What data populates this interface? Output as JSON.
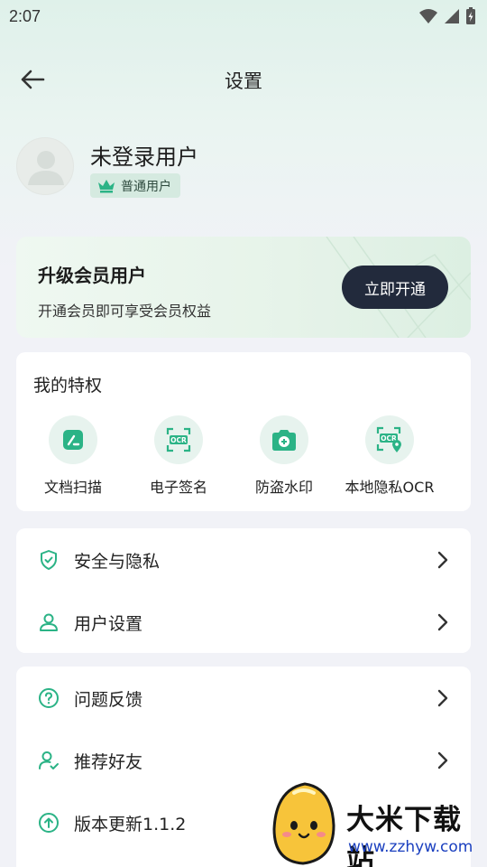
{
  "status_bar": {
    "time": "2:07"
  },
  "nav": {
    "title": "设置"
  },
  "profile": {
    "name": "未登录用户",
    "badge": "普通用户"
  },
  "vip": {
    "title": "升级会员用户",
    "subtitle": "开通会员即可享受会员权益",
    "button": "立即开通"
  },
  "privileges": {
    "title": "我的特权",
    "items": [
      {
        "label": "文档扫描",
        "icon": "document-scan-icon"
      },
      {
        "label": "电子签名",
        "icon": "ocr-icon"
      },
      {
        "label": "防盗水印",
        "icon": "camera-plus-icon"
      },
      {
        "label": "本地隐私OCR",
        "icon": "ocr-location-icon"
      }
    ]
  },
  "menu_group_1": [
    {
      "label": "安全与隐私",
      "icon": "shield-check-icon"
    },
    {
      "label": "用户设置",
      "icon": "user-icon"
    }
  ],
  "menu_group_2": [
    {
      "label": "问题反馈",
      "icon": "question-icon"
    },
    {
      "label": "推荐好友",
      "icon": "user-check-icon"
    },
    {
      "label": "版本更新1.1.2",
      "icon": "upload-icon"
    }
  ],
  "watermark": {
    "text": "大米下载站",
    "url": "www.zzhyw.com"
  },
  "colors": {
    "accent": "#2bb386",
    "vip_button": "#222a3c",
    "icon_bg": "#e7f3ee"
  }
}
